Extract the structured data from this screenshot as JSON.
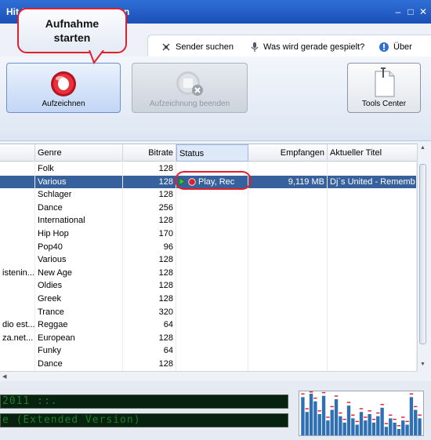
{
  "window": {
    "title": "Hit-P",
    "title_tail": "n",
    "min_icon": "minimize-icon",
    "max_icon": "maximize-icon",
    "close_icon": "close-icon"
  },
  "menu": [
    {
      "label": "Sender suchen",
      "icon": "antenna-icon"
    },
    {
      "label": "Was wird gerade gespielt?",
      "icon": "microphone-icon"
    },
    {
      "label": "Über",
      "icon": "info-icon"
    }
  ],
  "toolbar": {
    "record_label": "Aufzeichnen",
    "stop_label": "Aufzeichnung beenden",
    "tools_label": "Tools Center"
  },
  "callout": {
    "line1": "Aufnahme",
    "line2": "starten"
  },
  "colors": {
    "accent": "#e2202c",
    "selection": "#37619c"
  },
  "table": {
    "columns": [
      "Genre",
      "Bitrate",
      "Status",
      "Empfangen",
      "Aktueller Titel"
    ],
    "rows": [
      {
        "name": "",
        "genre": "Folk",
        "bitrate": "128",
        "status": "",
        "received": "",
        "title": ""
      },
      {
        "name": "",
        "genre": "Various",
        "bitrate": "128",
        "status": "Play, Rec",
        "received": "9,119 MB",
        "title": "Dj`s United - Rememb",
        "selected": true
      },
      {
        "name": "",
        "genre": "Schlager",
        "bitrate": "128",
        "status": "",
        "received": "",
        "title": ""
      },
      {
        "name": "",
        "genre": "Dance",
        "bitrate": "256",
        "status": "",
        "received": "",
        "title": ""
      },
      {
        "name": "",
        "genre": "International",
        "bitrate": "128",
        "status": "",
        "received": "",
        "title": ""
      },
      {
        "name": "",
        "genre": "Hip Hop",
        "bitrate": "170",
        "status": "",
        "received": "",
        "title": ""
      },
      {
        "name": "",
        "genre": "Pop40",
        "bitrate": "96",
        "status": "",
        "received": "",
        "title": ""
      },
      {
        "name": "",
        "genre": "Various",
        "bitrate": "128",
        "status": "",
        "received": "",
        "title": ""
      },
      {
        "name": "istenin...",
        "genre": "New Age",
        "bitrate": "128",
        "status": "",
        "received": "",
        "title": ""
      },
      {
        "name": "",
        "genre": "Oldies",
        "bitrate": "128",
        "status": "",
        "received": "",
        "title": ""
      },
      {
        "name": "",
        "genre": "Greek",
        "bitrate": "128",
        "status": "",
        "received": "",
        "title": ""
      },
      {
        "name": "",
        "genre": "Trance",
        "bitrate": "320",
        "status": "",
        "received": "",
        "title": ""
      },
      {
        "name": "dio est...",
        "genre": "Reggae",
        "bitrate": "64",
        "status": "",
        "received": "",
        "title": ""
      },
      {
        "name": "za.net...",
        "genre": "European",
        "bitrate": "128",
        "status": "",
        "received": "",
        "title": ""
      },
      {
        "name": "",
        "genre": "Funky",
        "bitrate": "64",
        "status": "",
        "received": "",
        "title": ""
      },
      {
        "name": "",
        "genre": "Dance",
        "bitrate": "128",
        "status": "",
        "received": "",
        "title": ""
      }
    ]
  },
  "lcd": {
    "line1": "2011 ::.",
    "line2": "e (Extended Version)"
  },
  "spectrum": {
    "levels": [
      0.9,
      0.55,
      0.98,
      0.8,
      0.5,
      0.93,
      0.35,
      0.6,
      0.85,
      0.45,
      0.3,
      0.7,
      0.4,
      0.25,
      0.55,
      0.35,
      0.5,
      0.3,
      0.45,
      0.65,
      0.2,
      0.4,
      0.3,
      0.15,
      0.35,
      0.25,
      0.9,
      0.6,
      0.4
    ]
  }
}
